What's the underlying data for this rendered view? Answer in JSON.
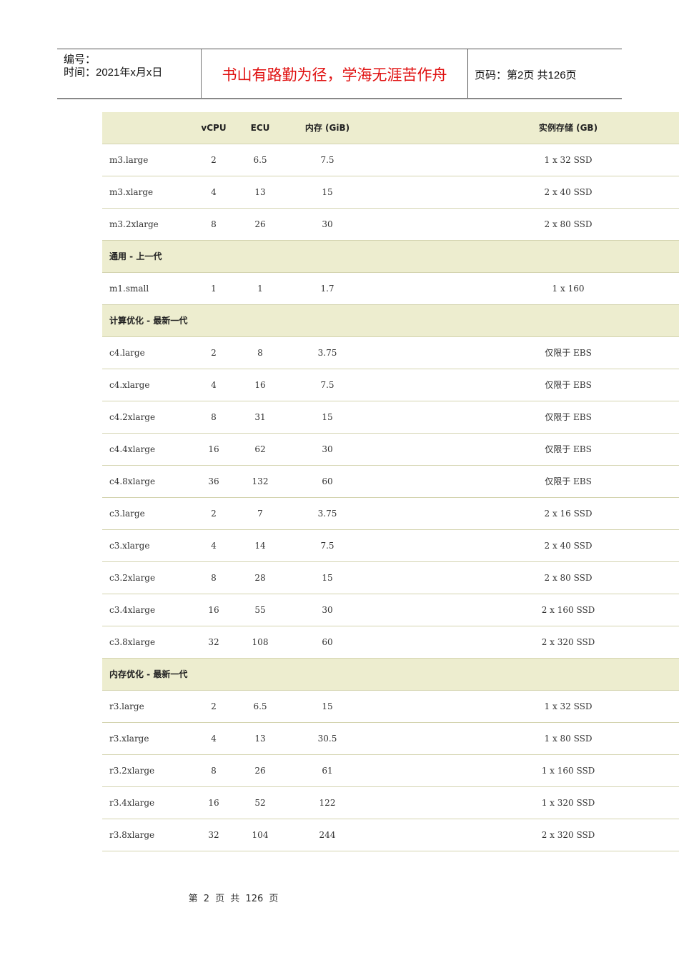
{
  "header": {
    "number_label": "编号：",
    "time_label": "时间：2021年x月x日",
    "motto": "书山有路勤为径，学海无涯苦作舟",
    "page_label": "页码：第2页 共126页"
  },
  "table": {
    "columns": [
      "",
      "vCPU",
      "ECU",
      "内存 (GiB)",
      "实例存储 (GB)"
    ],
    "rows": [
      {
        "type": "data",
        "cells": [
          "m3.large",
          "2",
          "6.5",
          "7.5",
          "1 x 32 SSD"
        ]
      },
      {
        "type": "data",
        "cells": [
          "m3.xlarge",
          "4",
          "13",
          "15",
          "2 x 40 SSD"
        ]
      },
      {
        "type": "data",
        "cells": [
          "m3.2xlarge",
          "8",
          "26",
          "30",
          "2 x 80 SSD"
        ]
      },
      {
        "type": "section",
        "label": "通用 - 上一代"
      },
      {
        "type": "data",
        "cells": [
          "m1.small",
          "1",
          "1",
          "1.7",
          "1 x 160"
        ]
      },
      {
        "type": "section",
        "label": "计算优化 - 最新一代"
      },
      {
        "type": "data",
        "cells": [
          "c4.large",
          "2",
          "8",
          "3.75",
          "仅限于 EBS"
        ]
      },
      {
        "type": "data",
        "cells": [
          "c4.xlarge",
          "4",
          "16",
          "7.5",
          "仅限于 EBS"
        ]
      },
      {
        "type": "data",
        "cells": [
          "c4.2xlarge",
          "8",
          "31",
          "15",
          "仅限于 EBS"
        ]
      },
      {
        "type": "data",
        "cells": [
          "c4.4xlarge",
          "16",
          "62",
          "30",
          "仅限于 EBS"
        ]
      },
      {
        "type": "data",
        "cells": [
          "c4.8xlarge",
          "36",
          "132",
          "60",
          "仅限于 EBS"
        ]
      },
      {
        "type": "data",
        "cells": [
          "c3.large",
          "2",
          "7",
          "3.75",
          "2 x 16 SSD"
        ]
      },
      {
        "type": "data",
        "cells": [
          "c3.xlarge",
          "4",
          "14",
          "7.5",
          "2 x 40 SSD"
        ]
      },
      {
        "type": "data",
        "cells": [
          "c3.2xlarge",
          "8",
          "28",
          "15",
          "2 x 80 SSD"
        ]
      },
      {
        "type": "data",
        "cells": [
          "c3.4xlarge",
          "16",
          "55",
          "30",
          "2 x 160 SSD"
        ]
      },
      {
        "type": "data",
        "cells": [
          "c3.8xlarge",
          "32",
          "108",
          "60",
          "2 x 320 SSD"
        ]
      },
      {
        "type": "section",
        "label": "内存优化 - 最新一代"
      },
      {
        "type": "data",
        "cells": [
          "r3.large",
          "2",
          "6.5",
          "15",
          "1 x 32 SSD"
        ]
      },
      {
        "type": "data",
        "cells": [
          "r3.xlarge",
          "4",
          "13",
          "30.5",
          "1 x 80 SSD"
        ]
      },
      {
        "type": "data",
        "cells": [
          "r3.2xlarge",
          "8",
          "26",
          "61",
          "1 x 160 SSD"
        ]
      },
      {
        "type": "data",
        "cells": [
          "r3.4xlarge",
          "16",
          "52",
          "122",
          "1 x 320 SSD"
        ]
      },
      {
        "type": "data",
        "cells": [
          "r3.8xlarge",
          "32",
          "104",
          "244",
          "2 x 320 SSD"
        ]
      }
    ]
  },
  "footer": {
    "page_text": "第 2 页 共 126 页"
  },
  "colors": {
    "motto": "#e01010",
    "row_band": "#ededcf",
    "row_border": "#d4d4b0"
  }
}
